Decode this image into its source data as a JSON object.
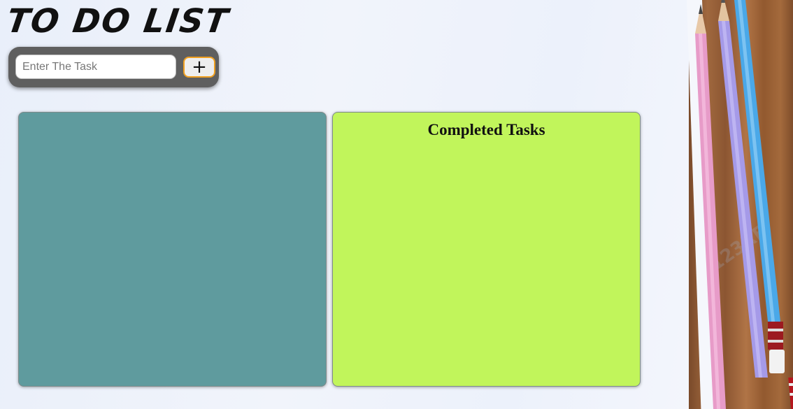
{
  "app": {
    "title": "TO DO LIST"
  },
  "input_bar": {
    "placeholder": "Enter The Task",
    "value": "",
    "add_button_label": "+"
  },
  "panels": {
    "pending": {
      "heading": "",
      "tasks": []
    },
    "completed": {
      "heading": "Completed Tasks",
      "tasks": []
    }
  },
  "colors": {
    "pending_bg": "#5f9b9e",
    "completed_bg": "#c1f55b",
    "input_bar_bg": "#5f5f5f",
    "add_button_border": "#f0a020"
  },
  "background": {
    "watermark": "123RF",
    "icons": [
      "pencil-pink",
      "pencil-purple",
      "pencil-blue"
    ]
  }
}
